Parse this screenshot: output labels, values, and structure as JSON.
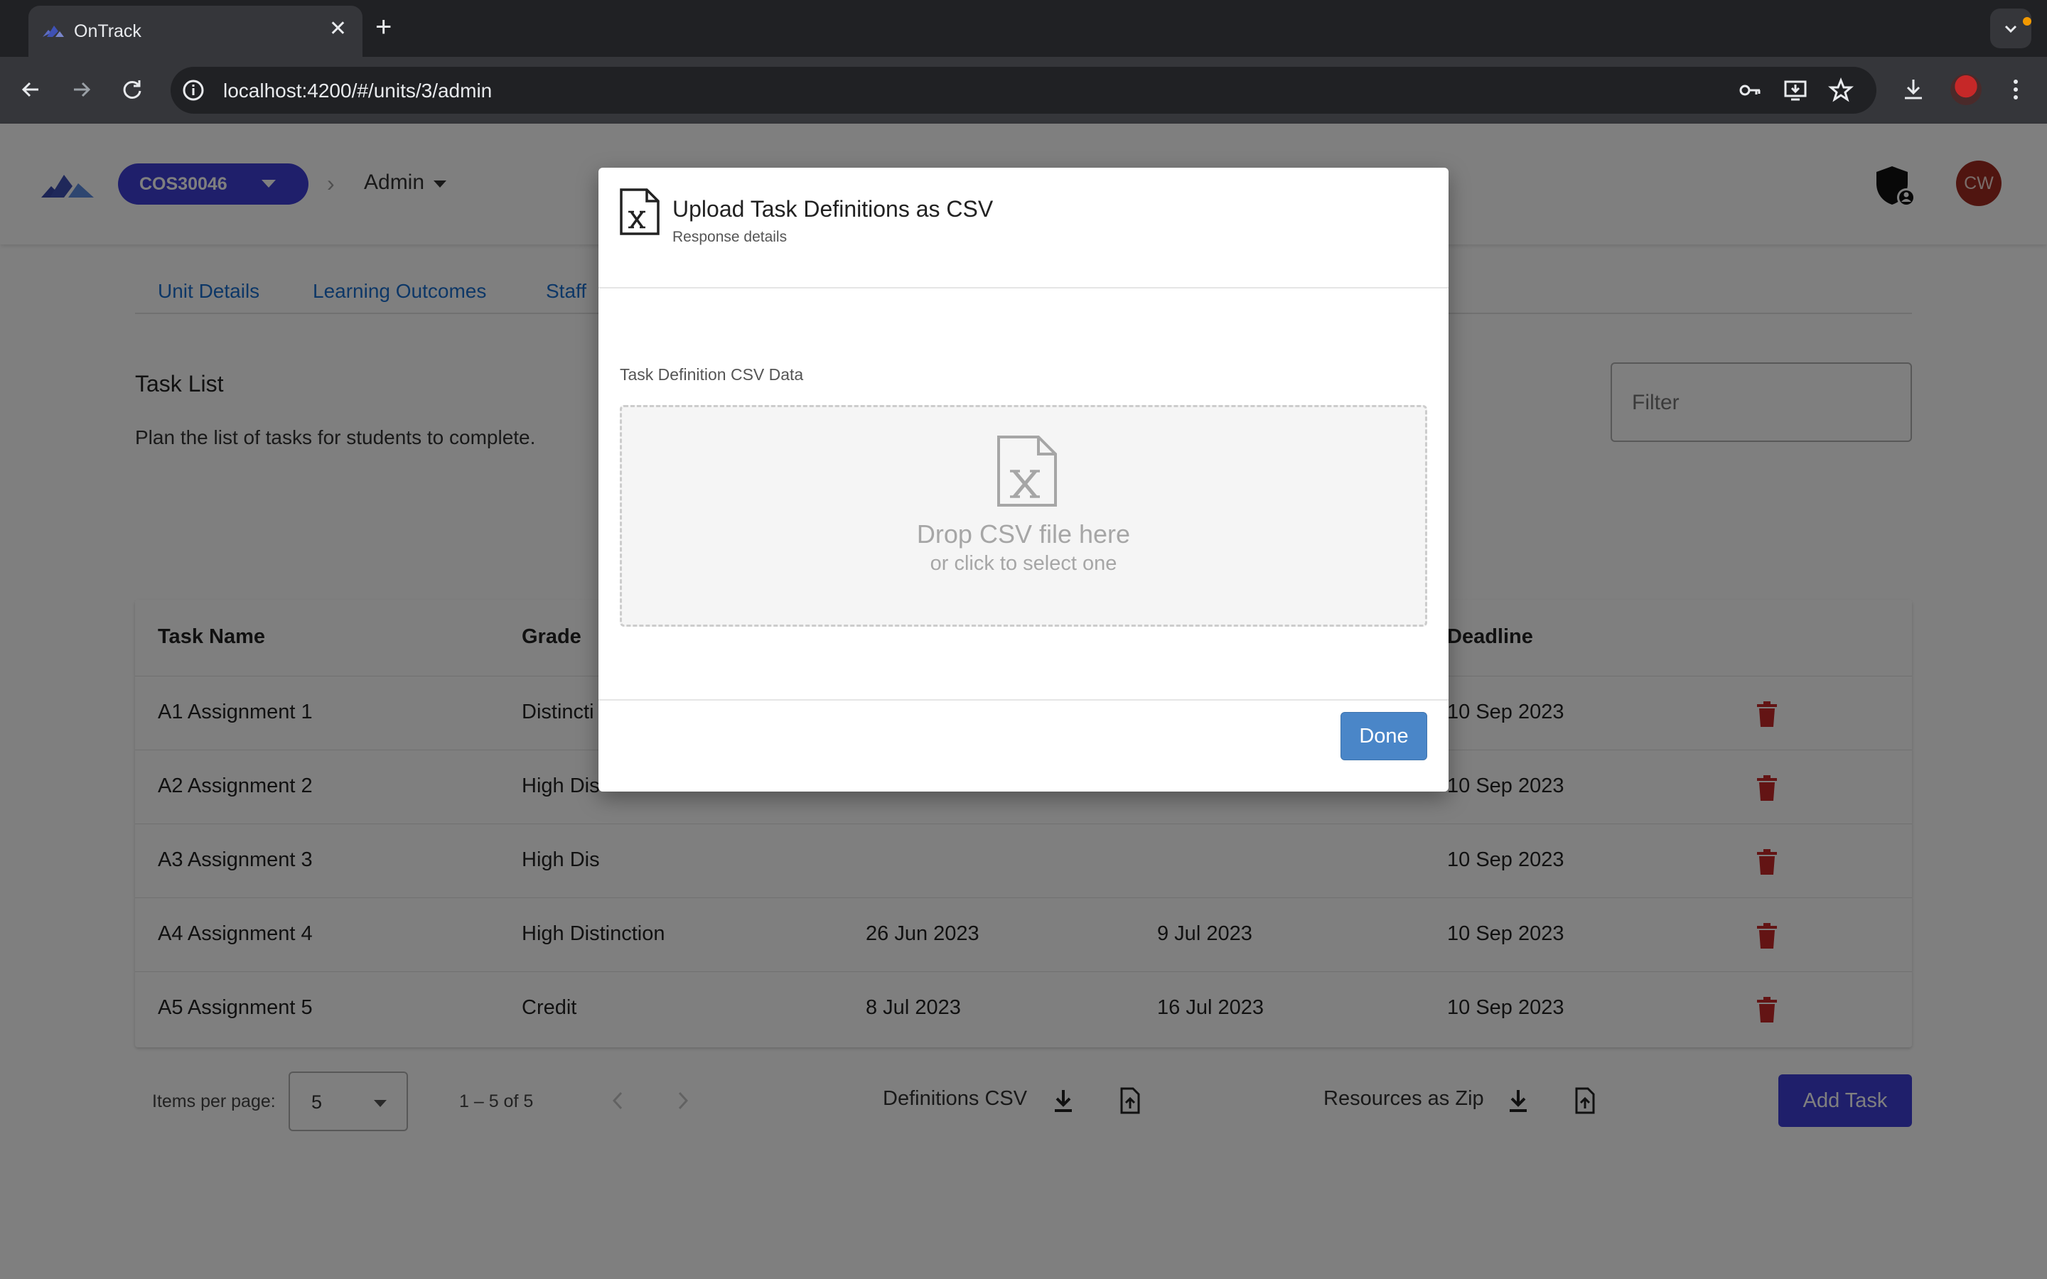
{
  "browser": {
    "tab_title": "OnTrack",
    "tab_close": "✕",
    "new_tab": "+",
    "url": "localhost:4200/#/units/3/admin"
  },
  "header": {
    "unit_code": "COS30046",
    "breadcrumb_separator": "›",
    "section": "Admin",
    "user_initials": "CW"
  },
  "tabs": [
    "Unit Details",
    "Learning Outcomes",
    "Staff"
  ],
  "task_list": {
    "title": "Task List",
    "description": "Plan the list of tasks for students to complete.",
    "filter_placeholder": "Filter",
    "columns": [
      "Task Name",
      "Grade",
      "Deadline"
    ],
    "rows": [
      {
        "name": "A1 Assignment 1",
        "grade": "Distincti",
        "start": "",
        "due": "",
        "deadline": "10 Sep 2023"
      },
      {
        "name": "A2 Assignment 2",
        "grade": "High Dis",
        "start": "",
        "due": "",
        "deadline": "10 Sep 2023"
      },
      {
        "name": "A3 Assignment 3",
        "grade": "High Dis",
        "start": "",
        "due": "",
        "deadline": "10 Sep 2023"
      },
      {
        "name": "A4 Assignment 4",
        "grade": "High Distinction",
        "start": "26 Jun 2023",
        "due": "9 Jul 2023",
        "deadline": "10 Sep 2023"
      },
      {
        "name": "A5 Assignment 5",
        "grade": "Credit",
        "start": "8 Jul 2023",
        "due": "16 Jul 2023",
        "deadline": "10 Sep 2023"
      }
    ]
  },
  "paginator": {
    "items_per_page_label": "Items per page:",
    "items_per_page_value": "5",
    "range_label": "1 – 5 of 5",
    "definitions_csv_label": "Definitions CSV",
    "resources_zip_label": "Resources as Zip",
    "add_task_label": "Add Task"
  },
  "dialog": {
    "title": "Upload Task Definitions as CSV",
    "subtitle": "Response details",
    "field_label": "Task Definition CSV Data",
    "drop_main": "Drop CSV file here",
    "drop_sub": "or click to select one",
    "done_label": "Done"
  },
  "colors": {
    "brand": "#3f3fd6",
    "link": "#1a6fcf",
    "danger": "#c62828",
    "done_button": "#4a86c8",
    "avatar": "#a12b20"
  },
  "icons": [
    "ontrack-logo-icon",
    "back-icon",
    "forward-icon",
    "reload-icon",
    "site-info-icon",
    "key-icon",
    "install-icon",
    "star-icon",
    "download-icon",
    "more-icon",
    "shield-icon",
    "trash-icon",
    "csv-file-icon",
    "upload-file-icon",
    "chevron-left-icon",
    "chevron-right-icon"
  ]
}
